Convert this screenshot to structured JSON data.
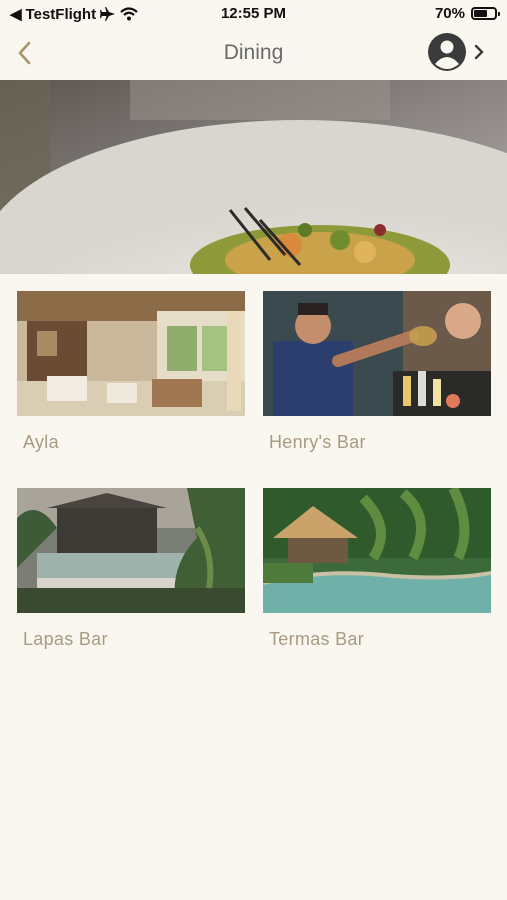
{
  "status_bar": {
    "carrier": "TestFlight",
    "time": "12:55 PM",
    "battery": "70%",
    "battery_level": 0.7
  },
  "nav": {
    "title": "Dining"
  },
  "venues": [
    {
      "name": "Ayla"
    },
    {
      "name": "Henry's Bar"
    },
    {
      "name": "Lapas Bar"
    },
    {
      "name": "Termas Bar"
    }
  ],
  "colors": {
    "background": "#faf7f1",
    "label": "#a89a82",
    "accent": "#a89466",
    "title": "#6a6a6a"
  }
}
